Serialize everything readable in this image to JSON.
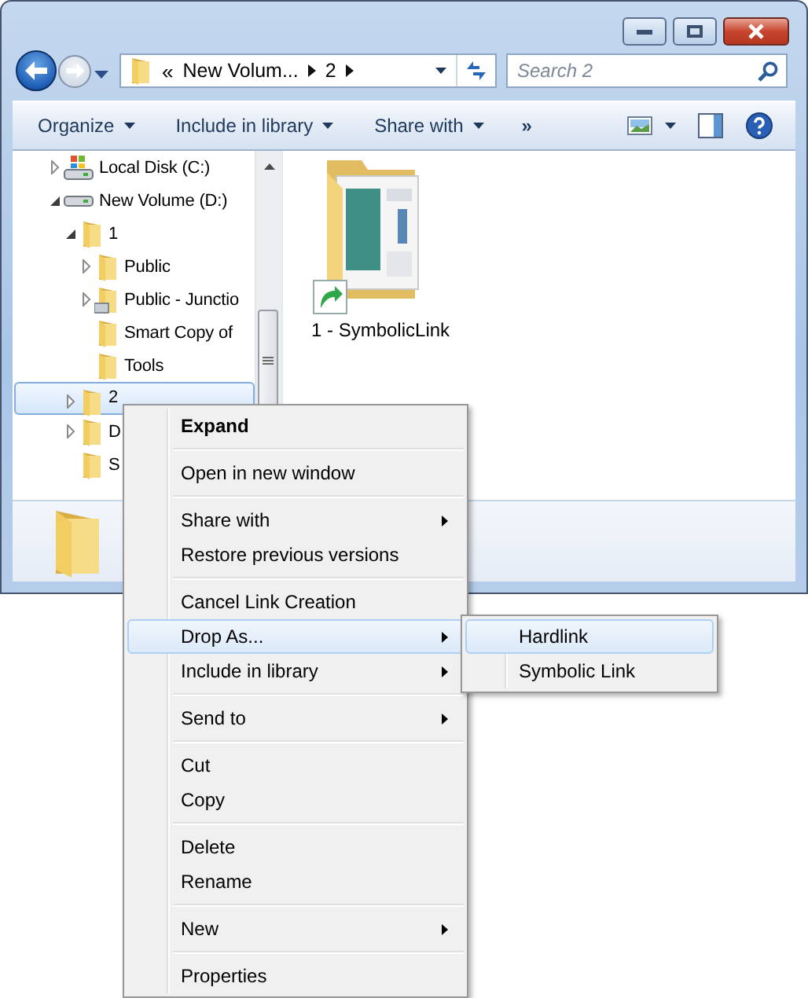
{
  "address_bar": {
    "overflow": "«",
    "crumbs": [
      "New Volum...",
      "2"
    ]
  },
  "search": {
    "placeholder": "Search 2"
  },
  "toolbar": {
    "buttons": [
      {
        "label": "Organize",
        "dropdown": true
      },
      {
        "label": "Include in library",
        "dropdown": true
      },
      {
        "label": "Share with",
        "dropdown": true
      }
    ],
    "more": "»"
  },
  "navigation_pane": {
    "items": [
      {
        "label": "Local Disk (C:)",
        "kind": "system-drive",
        "expanded": false,
        "selected": false
      },
      {
        "label": "New Volume (D:)",
        "kind": "drive",
        "expanded": true,
        "selected": false,
        "children": [
          {
            "label": "1",
            "kind": "folder",
            "expanded": true,
            "selected": false,
            "children": [
              {
                "label": "Public",
                "kind": "folder",
                "expanded": false,
                "selected": false
              },
              {
                "label": "Public - Junctio",
                "kind": "link-folder",
                "expanded": false,
                "selected": false
              },
              {
                "label": "Smart Copy of",
                "kind": "folder",
                "selected": false
              },
              {
                "label": "Tools",
                "kind": "folder",
                "selected": false
              }
            ]
          },
          {
            "label": "2",
            "kind": "folder",
            "expanded": false,
            "selected": true
          },
          {
            "label": "D",
            "kind": "folder",
            "expanded": false,
            "selected": false
          },
          {
            "label": "S",
            "kind": "folder",
            "selected": false
          }
        ]
      }
    ]
  },
  "files": [
    {
      "name": "1 - SymbolicLink",
      "kind": "symlink-folder"
    }
  ],
  "context_menu": {
    "groups": [
      [
        {
          "label": "Expand",
          "default": true,
          "submenu": false,
          "selected": false
        }
      ],
      [
        {
          "label": "Open in new window",
          "default": false,
          "submenu": false,
          "selected": false
        }
      ],
      [
        {
          "label": "Share with",
          "default": false,
          "submenu": true,
          "selected": false
        },
        {
          "label": "Restore previous versions",
          "default": false,
          "submenu": false,
          "selected": false
        }
      ],
      [
        {
          "label": "Cancel Link Creation",
          "default": false,
          "submenu": false,
          "selected": false
        },
        {
          "label": "Drop As...",
          "default": false,
          "submenu": true,
          "selected": true
        },
        {
          "label": "Include in library",
          "default": false,
          "submenu": true,
          "selected": false
        }
      ],
      [
        {
          "label": "Send to",
          "default": false,
          "submenu": true,
          "selected": false
        }
      ],
      [
        {
          "label": "Cut",
          "default": false,
          "submenu": false,
          "selected": false
        },
        {
          "label": "Copy",
          "default": false,
          "submenu": false,
          "selected": false
        }
      ],
      [
        {
          "label": "Delete",
          "default": false,
          "submenu": false,
          "selected": false
        },
        {
          "label": "Rename",
          "default": false,
          "submenu": false,
          "selected": false
        }
      ],
      [
        {
          "label": "New",
          "default": false,
          "submenu": true,
          "selected": false
        }
      ],
      [
        {
          "label": "Properties",
          "default": false,
          "submenu": false,
          "selected": false
        }
      ]
    ]
  },
  "submenu": {
    "items": [
      {
        "label": "Hardlink",
        "default": false,
        "submenu": false,
        "selected": true
      },
      {
        "label": "Symbolic Link",
        "default": false,
        "submenu": false,
        "selected": false
      }
    ]
  }
}
